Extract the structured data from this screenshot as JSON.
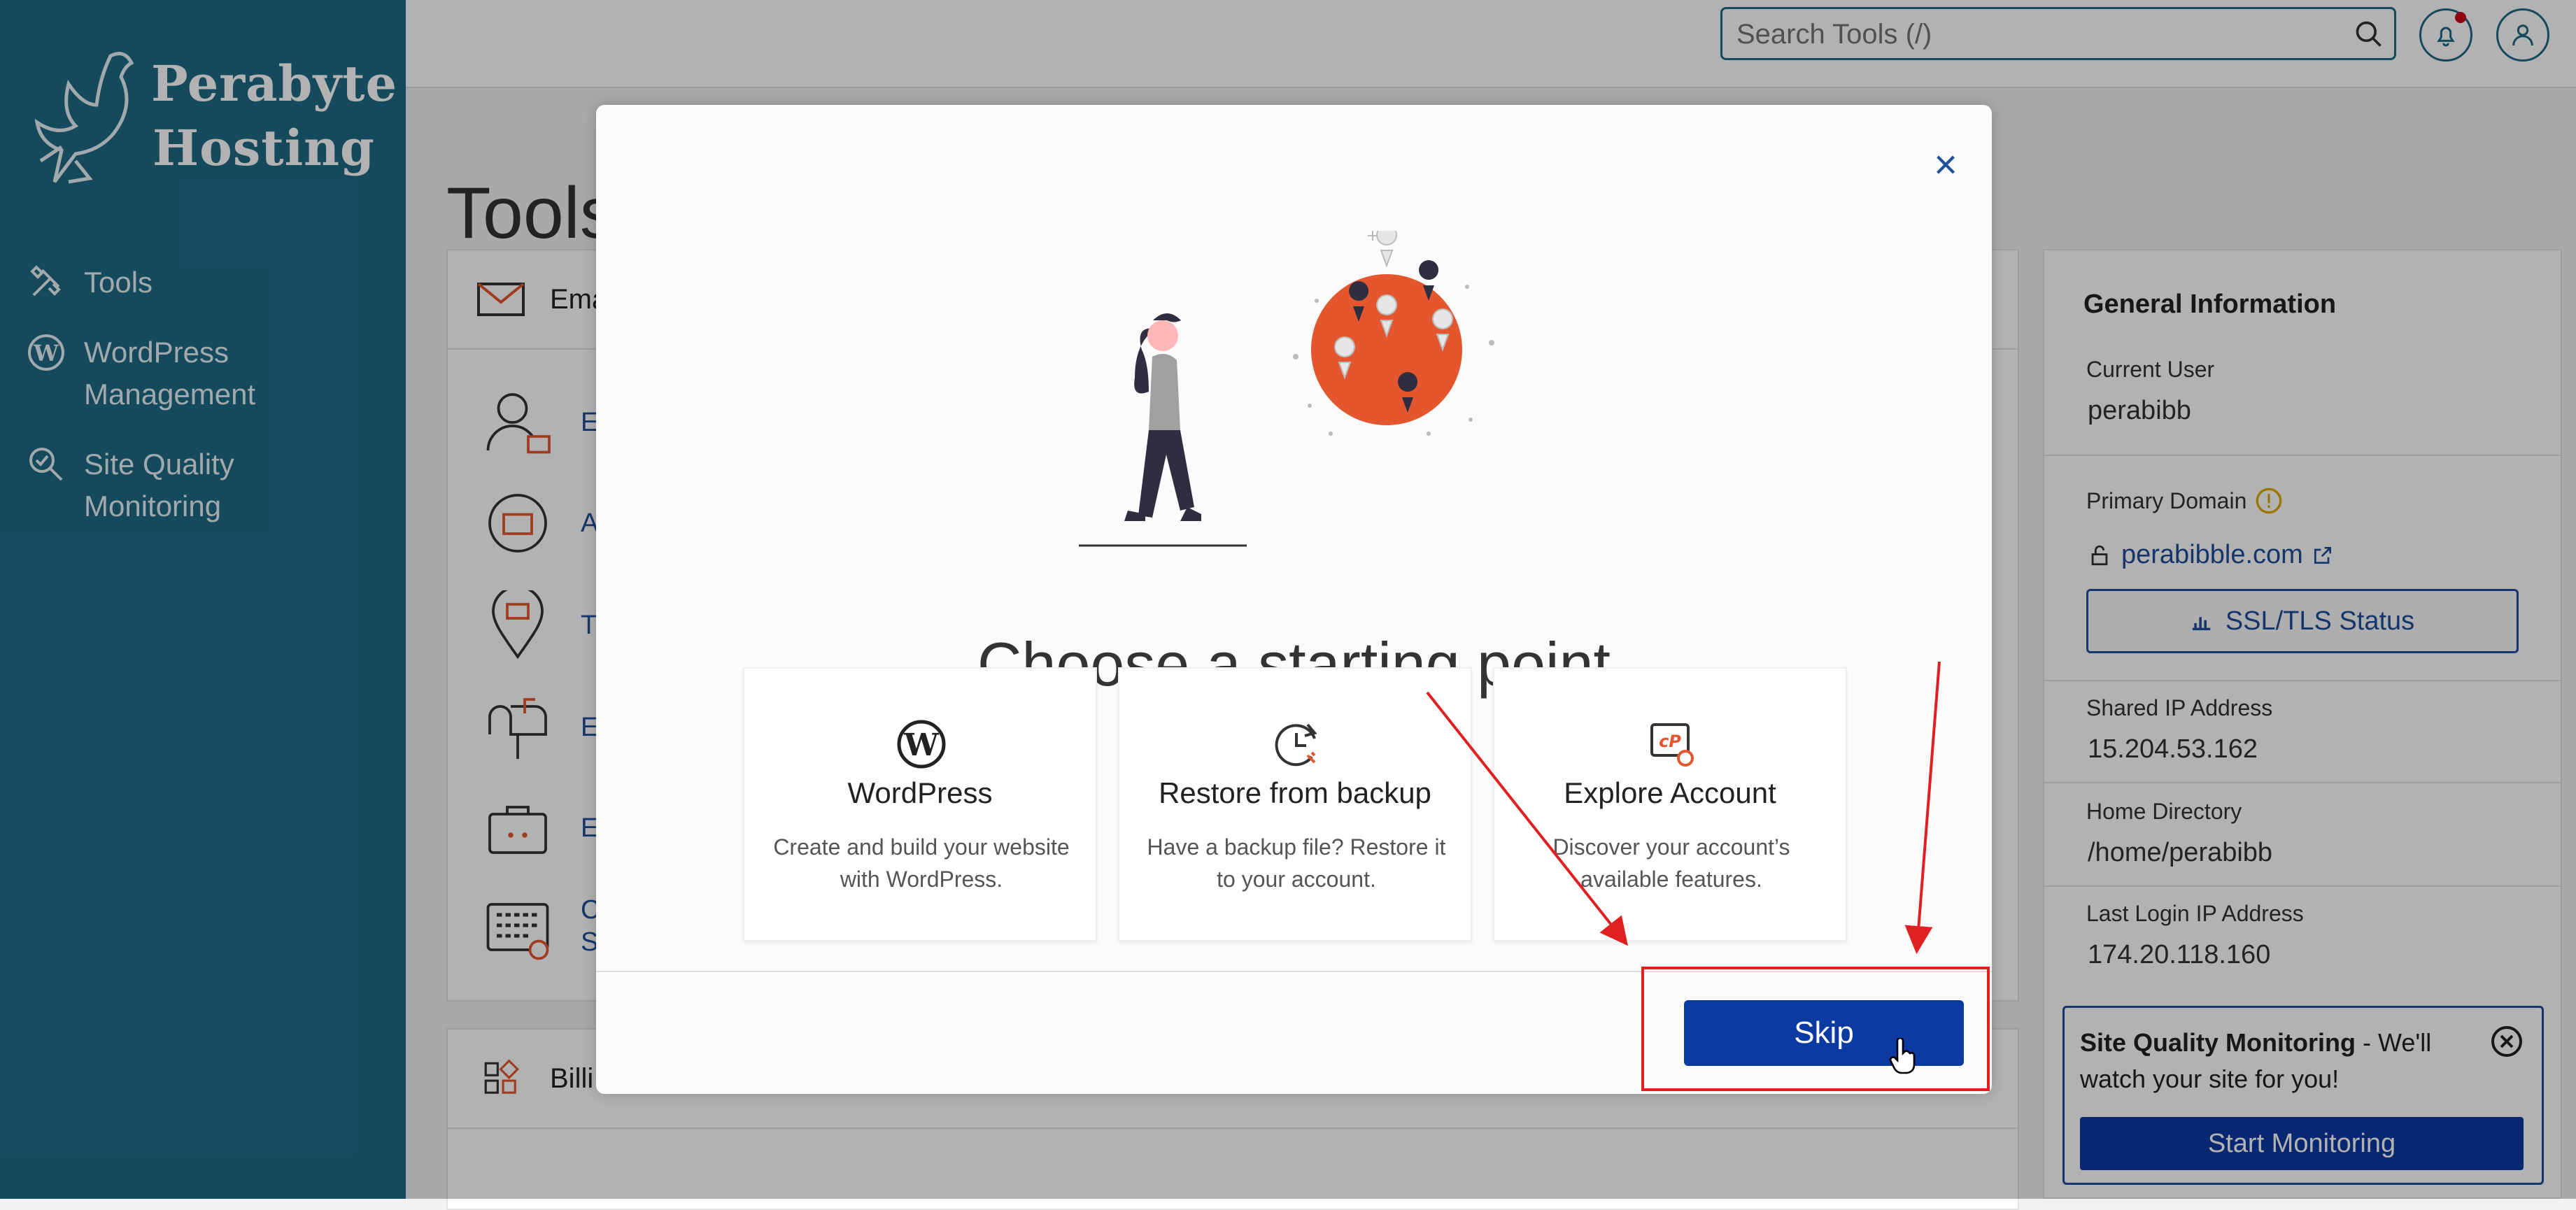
{
  "sidebar": {
    "brand_line1": "Perabyte",
    "brand_line2": "Hosting",
    "items": [
      {
        "label": "Tools",
        "icon": "tools-icon"
      },
      {
        "label_line1": "WordPress",
        "label_line2": "Management",
        "icon": "wordpress-icon"
      },
      {
        "label_line1": "Site Quality",
        "label_line2": "Monitoring",
        "icon": "magnify-icon"
      }
    ]
  },
  "header": {
    "search_placeholder": "Search Tools (/)"
  },
  "page": {
    "title": "Tools",
    "email_section": "Ema",
    "billing_section": "Billi",
    "tool_rows": [
      "Er",
      "Au",
      "Tr",
      "Er",
      "Er",
      "Ca",
      "Sh"
    ]
  },
  "info": {
    "heading": "General Information",
    "current_user_label": "Current User",
    "current_user": "perabibb",
    "primary_domain_label": "Primary Domain",
    "primary_domain": "perabibble.com",
    "ssl_button": "SSL/TLS Status",
    "shared_ip_label": "Shared IP Address",
    "shared_ip": "15.204.53.162",
    "home_dir_label": "Home Directory",
    "home_dir": "/home/perabibb",
    "last_login_label": "Last Login IP Address",
    "last_login": "174.20.118.160"
  },
  "sqm_card": {
    "title": "Site Quality Monitoring",
    "text": " - We'll watch your site for you!",
    "button": "Start Monitoring"
  },
  "modal": {
    "title": "Choose a starting point",
    "close": "×",
    "cards": [
      {
        "title": "WordPress",
        "desc": "Create and build your website with WordPress.",
        "icon": "wordpress-icon"
      },
      {
        "title": "Restore from backup",
        "desc": "Have a backup file? Restore it to your account.",
        "icon": "restore-clock-icon"
      },
      {
        "title": "Explore Account",
        "desc": "Discover your account’s available features.",
        "icon": "cpanel-icon"
      }
    ],
    "skip_button": "Skip"
  },
  "colors": {
    "sidebar": "#1f6a86",
    "primary_button": "#0b3aa2",
    "accent_orange": "#e4572e",
    "annotation_red": "#e02020"
  }
}
